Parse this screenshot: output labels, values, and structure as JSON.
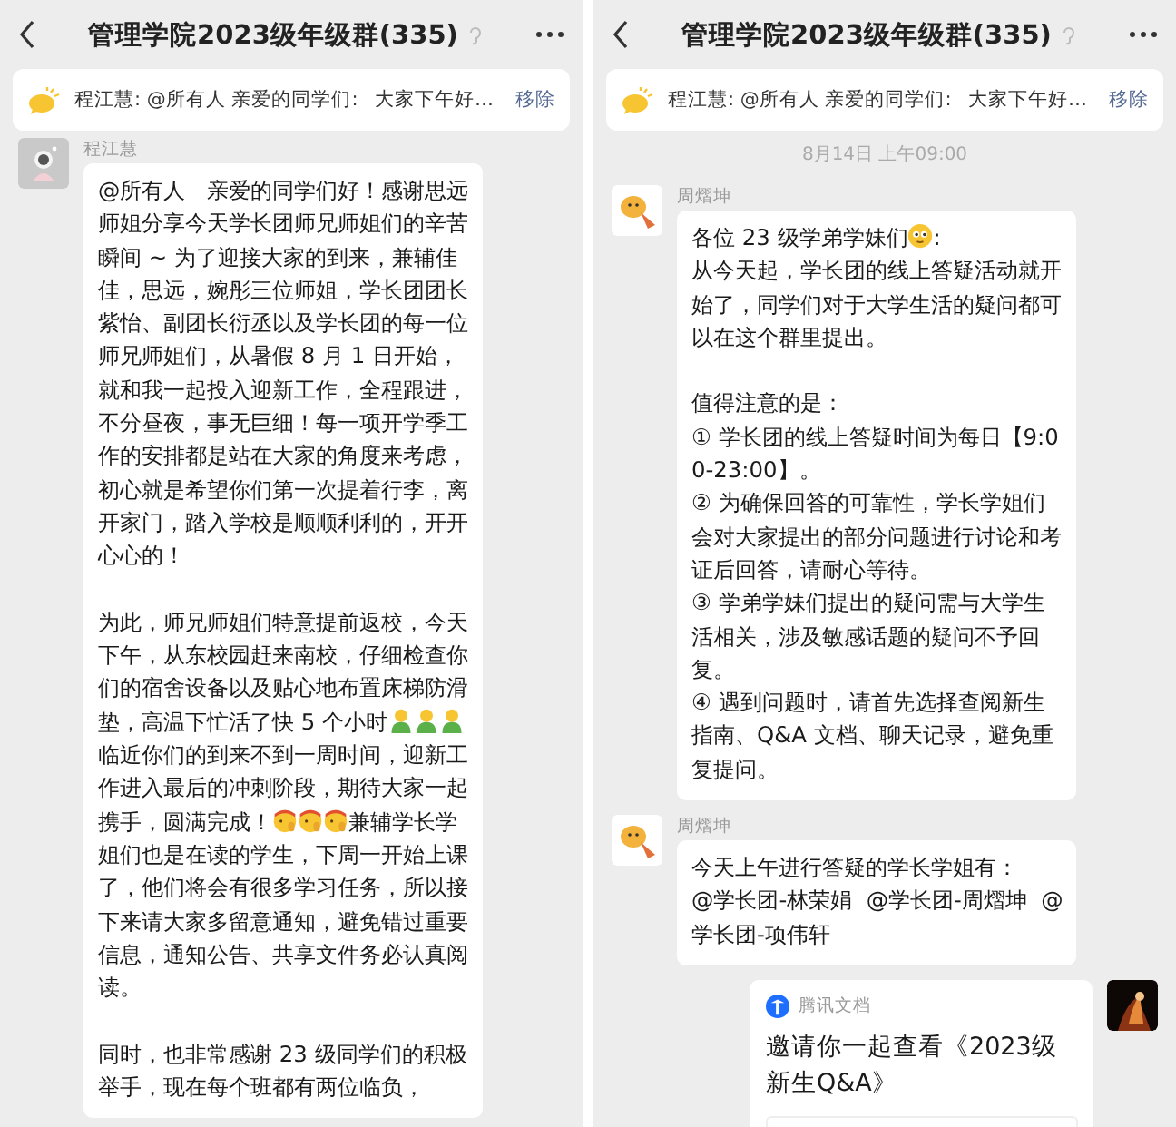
{
  "panels": [
    {
      "header": {
        "title": "管理学院2023级年级群(335)"
      },
      "pinned": {
        "text": "程江慧: @所有人 亲爱的同学们:",
        "continuation": "大家下午好…",
        "action": "移除"
      },
      "messages": [
        {
          "kind": "text",
          "sender": "程江慧",
          "paragraphs": [
            {
              "parts": [
                {
                  "kind": "text",
                  "text": "@所有人　亲爱的同学们好！感谢思远师姐分享今天学长团师兄师姐们的辛苦瞬间 ~ 为了迎接大家的到来，兼辅佳佳，思远，婉彤三位师姐，学长团团长紫怡、副团长衍丞以及学长团的每一位师兄师姐们，从暑假 8 月 1 日开始，就和我一起投入迎新工作，全程跟进，不分昼夜，事无巨细！每一项开学季工作的安排都是站在大家的角度来考虑，初心就是希望你们第一次提着行李，离开家门，踏入学校是顺顺利利的，开开心心的！"
                }
              ]
            },
            {
              "parts": [
                {
                  "kind": "text",
                  "text": "为此，师兄师姐们特意提前返校，今天下午，从东校园赶来南校，仔细检查你们的宿舍设备以及贴心地布置床梯防滑垫，高温下忙活了快 5 个小时"
                },
                {
                  "kind": "figure-emoji"
                },
                {
                  "kind": "figure-emoji"
                },
                {
                  "kind": "figure-emoji"
                },
                {
                  "kind": "text",
                  "text": "临近你们的到来不到一周时间，迎新工作进入最后的冲刺阶段，期待大家一起携手，圆满完成！"
                },
                {
                  "kind": "salute-emoji"
                },
                {
                  "kind": "salute-emoji"
                },
                {
                  "kind": "salute-emoji"
                },
                {
                  "kind": "text",
                  "text": "兼辅学长学姐们也是在读的学生，下周一开始上课了，他们将会有很多学习任务，所以接下来请大家多留意通知，避免错过重要信息，通知公告、共享文件务必认真阅读。"
                }
              ]
            },
            {
              "parts": [
                {
                  "kind": "text",
                  "text": "同时，也非常感谢 23 级同学们的积极举手，现在每个班都有两位临负，"
                }
              ]
            }
          ]
        }
      ]
    },
    {
      "header": {
        "title": "管理学院2023级年级群(335)"
      },
      "pinned": {
        "text": "程江慧: @所有人 亲爱的同学们:",
        "continuation": "大家下午好…",
        "action": "移除"
      },
      "messages": [
        {
          "kind": "timestamp",
          "text": "8月14日 上午09:00"
        },
        {
          "kind": "text",
          "sender": "周熠坤",
          "paragraphs": [
            {
              "parts": [
                {
                  "kind": "text",
                  "text": "各位 23 级学弟学妹们"
                },
                {
                  "kind": "smile-emoji"
                },
                {
                  "kind": "text",
                  "text": ":\n从今天起，学长团的线上答疑活动就开始了，同学们对于大学生活的疑问都可以在这个群里提出。"
                }
              ]
            },
            {
              "parts": [
                {
                  "kind": "text",
                  "text": "值得注意的是：\n① 学长团的线上答疑时间为每日【9:00-23:00】。\n② 为确保回答的可靠性，学长学姐们会对大家提出的部分问题进行讨论和考证后回答，请耐心等待。\n③ 学弟学妹们提出的疑问需与大学生活相关，涉及敏感话题的疑问不予回复。\n④ 遇到问题时，请首先选择查阅新生指南、Q&A 文档、聊天记录，避免重复提问。"
                }
              ]
            }
          ]
        },
        {
          "kind": "text",
          "sender": "周熠坤",
          "paragraphs": [
            {
              "parts": [
                {
                  "kind": "text",
                  "text": "今天上午进行答疑的学长学姐有：\n@学长团-林荣娟  @学长团-周熠坤  @学长团-项伟轩"
                }
              ]
            }
          ]
        },
        {
          "kind": "doc",
          "source": "腾讯文档",
          "title": "邀请你一起查看《2023级新生Q&A》"
        }
      ]
    }
  ]
}
